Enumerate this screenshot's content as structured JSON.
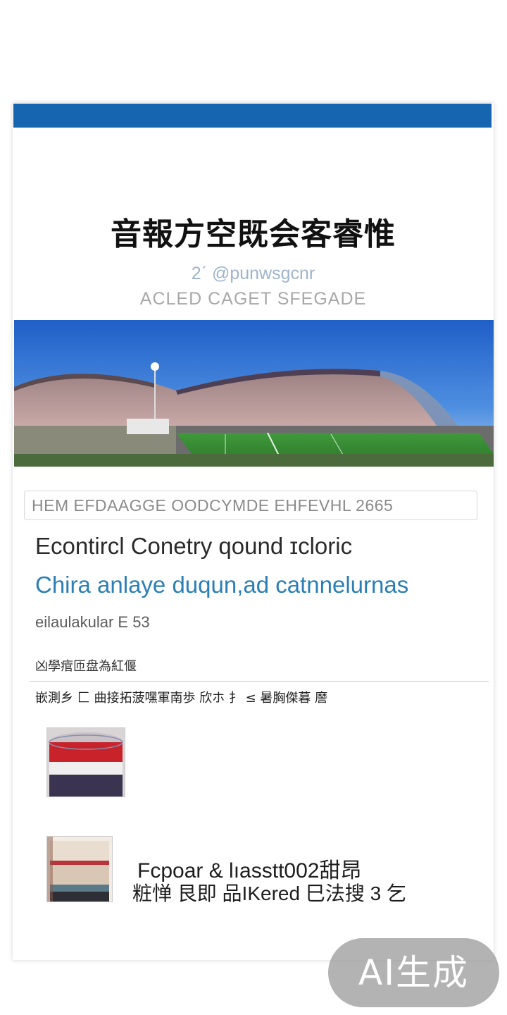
{
  "card": {
    "headline": "音報方空既会客睿惟",
    "subline_1": "2ˊ @punwsgcnr",
    "subline_2": "ACLED CAGET SFEGADE",
    "caption": "HEM EFDAAGGE OODCYMDE EHFEVHL 2665",
    "title_line": "Econtircl Conetry qound ɪcloric",
    "title_line_blue": "Chira anlaye duqun,ad catnnelurnas",
    "meta_line": "eilaulakular E 53",
    "small_line_1": "凶學痯匝盘為紅偃",
    "small_line_2": "嵌測乡 匚 曲接拓菠嘿軍南歩 欣ホ 扌 ≤ 暑胸傑暮 䜆",
    "item_line_1": "Fcpoar & lıasstt002甜昂",
    "item_line_2": "粧惮 艮即 品IKered 巳法搜 3 乞"
  },
  "badge": {
    "label": "AI生成"
  },
  "colors": {
    "top_bar": "#1565b0",
    "blue_text": "#2b7fb5",
    "badge_bg": "#969696"
  }
}
